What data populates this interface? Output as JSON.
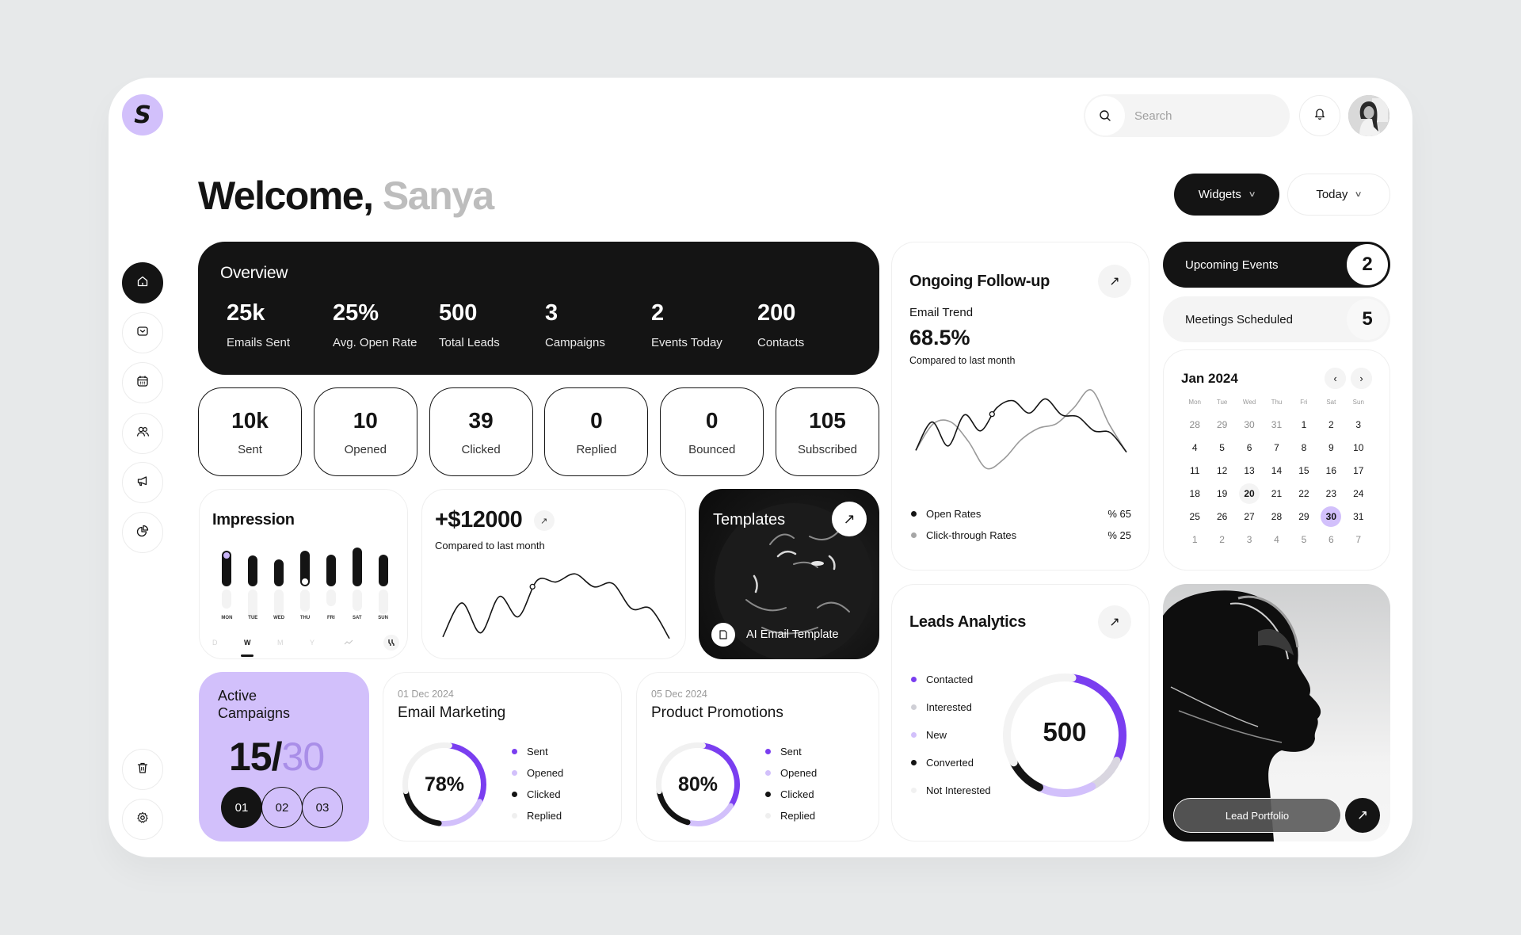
{
  "app": {
    "logo_letter": "S"
  },
  "header": {
    "search_placeholder": "Search",
    "welcome_prefix": "Welcome,",
    "user_name": "Sanya",
    "widgets_label": "Widgets",
    "range_label": "Today"
  },
  "sidebar": {
    "items": [
      {
        "name": "home",
        "icon": "home-icon",
        "active": true
      },
      {
        "name": "mail",
        "icon": "mail-icon",
        "active": false
      },
      {
        "name": "calendar",
        "icon": "calendar-icon",
        "active": false
      },
      {
        "name": "contacts",
        "icon": "users-icon",
        "active": false
      },
      {
        "name": "campaigns",
        "icon": "megaphone-icon",
        "active": false
      },
      {
        "name": "reports",
        "icon": "pie-chart-icon",
        "active": false
      }
    ],
    "bottom": [
      {
        "name": "trash",
        "icon": "trash-icon"
      },
      {
        "name": "settings",
        "icon": "gear-icon"
      }
    ]
  },
  "overview": {
    "title": "Overview",
    "stats": [
      {
        "value": "25k",
        "label": "Emails Sent"
      },
      {
        "value": "25%",
        "label": "Avg. Open Rate"
      },
      {
        "value": "500",
        "label": "Total Leads"
      },
      {
        "value": "3",
        "label": "Campaigns"
      },
      {
        "value": "2",
        "label": "Events Today"
      },
      {
        "value": "200",
        "label": "Contacts"
      }
    ]
  },
  "email_stats": [
    {
      "value": "10k",
      "label": "Sent"
    },
    {
      "value": "10",
      "label": "Opened"
    },
    {
      "value": "39",
      "label": "Clicked"
    },
    {
      "value": "0",
      "label": "Replied"
    },
    {
      "value": "0",
      "label": "Bounced"
    },
    {
      "value": "105",
      "label": "Subscribed"
    }
  ],
  "impression": {
    "title": "Impression",
    "days": [
      "MON",
      "TUE",
      "WED",
      "THU",
      "FRI",
      "SAT",
      "SUN"
    ],
    "values": [
      0.62,
      0.5,
      0.4,
      0.62,
      0.53,
      0.7,
      0.53
    ],
    "ghost_values": [
      0.25,
      0.5,
      0.42,
      0.33,
      0.2,
      0.3,
      0.38
    ],
    "ranges": [
      "D",
      "W",
      "M",
      "Y"
    ],
    "active_range": "W",
    "markers": {
      "MON": "#c9b5f7",
      "THU": "#ffffff"
    }
  },
  "revenue": {
    "value": "+$12000",
    "subtitle": "Compared to last month",
    "chart_data": {
      "type": "line",
      "values": [
        10,
        52,
        15,
        60,
        35,
        80,
        78,
        88,
        72,
        76,
        45,
        45,
        8
      ]
    }
  },
  "templates": {
    "title": "Templates",
    "link_label": "AI Email Template"
  },
  "followup": {
    "title": "Ongoing Follow-up",
    "trend_label": "Email Trend",
    "trend_value": "68.5%",
    "subtitle": "Compared to last month",
    "chart_data": {
      "type": "line",
      "series": [
        {
          "name": "Open Rates",
          "color": "#141414",
          "values": [
            30,
            62,
            35,
            70,
            52,
            78,
            86,
            72,
            88,
            70,
            68,
            52,
            50,
            28
          ]
        },
        {
          "name": "Click-through Rates",
          "color": "#9a9a9a",
          "values": [
            30,
            60,
            62,
            40,
            10,
            20,
            42,
            55,
            60,
            78,
            98,
            60,
            28
          ]
        }
      ]
    },
    "legend": [
      {
        "label": "Open Rates",
        "value": "% 65",
        "color": "#141414"
      },
      {
        "label": "Click-through Rates",
        "value": "% 25",
        "color": "#a6a6a6"
      }
    ]
  },
  "events": {
    "label": "Upcoming Events",
    "count": "2"
  },
  "meetings": {
    "label": "Meetings Scheduled",
    "count": "5"
  },
  "calendar": {
    "month": "Jan 2024",
    "weekdays": [
      "Mon",
      "Tue",
      "Wed",
      "Thu",
      "Fri",
      "Sat",
      "Sun"
    ],
    "days": [
      {
        "d": "28",
        "m": true
      },
      {
        "d": "29",
        "m": true
      },
      {
        "d": "30",
        "m": true
      },
      {
        "d": "31",
        "m": true
      },
      {
        "d": "1"
      },
      {
        "d": "2"
      },
      {
        "d": "3"
      },
      {
        "d": "4"
      },
      {
        "d": "5"
      },
      {
        "d": "6"
      },
      {
        "d": "7"
      },
      {
        "d": "8"
      },
      {
        "d": "9"
      },
      {
        "d": "10"
      },
      {
        "d": "11"
      },
      {
        "d": "12"
      },
      {
        "d": "13"
      },
      {
        "d": "14"
      },
      {
        "d": "15"
      },
      {
        "d": "16"
      },
      {
        "d": "17"
      },
      {
        "d": "18"
      },
      {
        "d": "19"
      },
      {
        "d": "20",
        "hl": true
      },
      {
        "d": "21"
      },
      {
        "d": "22"
      },
      {
        "d": "23"
      },
      {
        "d": "24"
      },
      {
        "d": "25"
      },
      {
        "d": "26"
      },
      {
        "d": "27"
      },
      {
        "d": "28"
      },
      {
        "d": "29"
      },
      {
        "d": "30",
        "sel": true
      },
      {
        "d": "31"
      },
      {
        "d": "1",
        "m": true
      },
      {
        "d": "2",
        "m": true
      },
      {
        "d": "3",
        "m": true
      },
      {
        "d": "4",
        "m": true
      },
      {
        "d": "5",
        "m": true
      },
      {
        "d": "6",
        "m": true
      },
      {
        "d": "7",
        "m": true
      }
    ]
  },
  "leads": {
    "title": "Leads Analytics",
    "total": "500",
    "legend": [
      {
        "label": "Contacted",
        "color": "#7a3ef0"
      },
      {
        "label": "Interested",
        "color": "#cfcfd6"
      },
      {
        "label": "New",
        "color": "#d2c0fb"
      },
      {
        "label": "Converted",
        "color": "#141414"
      },
      {
        "label": "Not Interested",
        "color": "#f1f1f1"
      }
    ],
    "chart_data": {
      "type": "pie",
      "segments": [
        {
          "label": "Contacted",
          "fraction": 0.3,
          "color": "#7a3ef0"
        },
        {
          "label": "Interested",
          "fraction": 0.1,
          "color": "#d9d6e0"
        },
        {
          "label": "New",
          "fraction": 0.15,
          "color": "#d2c0fb"
        },
        {
          "label": "Converted",
          "fraction": 0.1,
          "color": "#141414"
        },
        {
          "label": "Not Interested",
          "fraction": 0.35,
          "color": "#f3f3f3"
        }
      ]
    }
  },
  "portfolio": {
    "button_label": "Lead Portfolio"
  },
  "active_campaigns": {
    "title_line1": "Active",
    "title_line2": "Campaigns",
    "current": "15/",
    "total": "30",
    "steps": [
      "01",
      "02",
      "03"
    ],
    "active_step": "01"
  },
  "campaigns": [
    {
      "date": "01 Dec 2024",
      "title": "Email Marketing",
      "percent": "78%",
      "legend": [
        {
          "label": "Sent",
          "color": "#7a3ef0"
        },
        {
          "label": "Opened",
          "color": "#d2c0fb"
        },
        {
          "label": "Clicked",
          "color": "#141414"
        },
        {
          "label": "Replied",
          "color": "#efefef"
        }
      ],
      "chart_data": {
        "type": "pie",
        "segments": [
          {
            "label": "Sent",
            "fraction": 0.3,
            "color": "#7a3ef0"
          },
          {
            "label": "Opened",
            "fraction": 0.2,
            "color": "#d2c0fb"
          },
          {
            "label": "Clicked",
            "fraction": 0.2,
            "color": "#141414"
          },
          {
            "label": "Replied",
            "fraction": 0.3,
            "color": "#f1f1f1"
          }
        ]
      }
    },
    {
      "date": "05 Dec 2024",
      "title": "Product Promotions",
      "percent": "80%",
      "legend": [
        {
          "label": "Sent",
          "color": "#7a3ef0"
        },
        {
          "label": "Opened",
          "color": "#d2c0fb"
        },
        {
          "label": "Clicked",
          "color": "#141414"
        },
        {
          "label": "Replied",
          "color": "#efefef"
        }
      ],
      "chart_data": {
        "type": "pie",
        "segments": [
          {
            "label": "Sent",
            "fraction": 0.32,
            "color": "#7a3ef0"
          },
          {
            "label": "Opened",
            "fraction": 0.2,
            "color": "#d2c0fb"
          },
          {
            "label": "Clicked",
            "fraction": 0.18,
            "color": "#141414"
          },
          {
            "label": "Replied",
            "fraction": 0.3,
            "color": "#f1f1f1"
          }
        ]
      }
    }
  ]
}
